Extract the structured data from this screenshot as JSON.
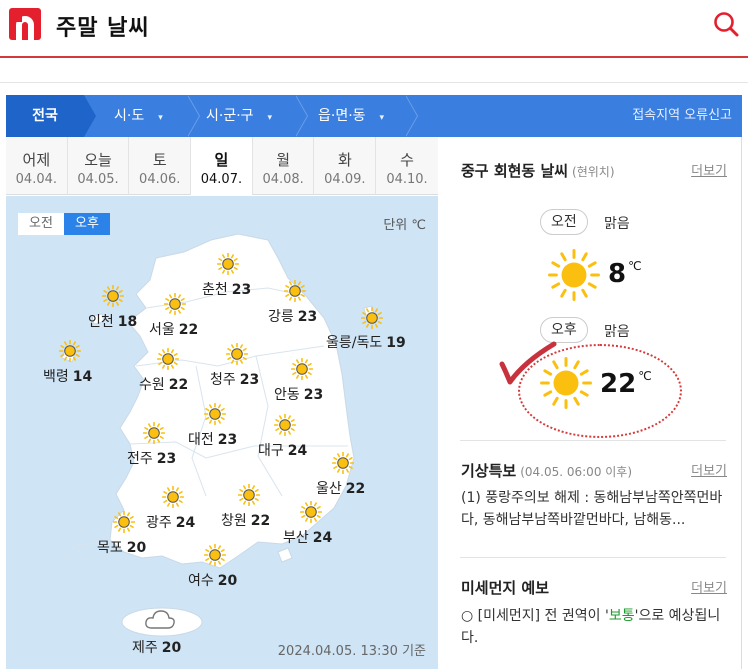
{
  "header": {
    "title": "주말 날씨"
  },
  "nav": {
    "first": "전국",
    "items": [
      {
        "label": "시·도",
        "caret": "▾"
      },
      {
        "label": "시·군·구",
        "caret": "▾"
      },
      {
        "label": "읍·면·동",
        "caret": "▾"
      }
    ],
    "report": "접속지역 오류신고"
  },
  "days": [
    {
      "name": "어제",
      "date": "04.04."
    },
    {
      "name": "오늘",
      "date": "04.05."
    },
    {
      "name": "토",
      "date": "04.06."
    },
    {
      "name": "일",
      "date": "04.07.",
      "active": true
    },
    {
      "name": "월",
      "date": "04.08."
    },
    {
      "name": "화",
      "date": "04.09."
    },
    {
      "name": "수",
      "date": "04.10."
    }
  ],
  "map": {
    "am_label": "오전",
    "pm_label": "오후",
    "unit": "단위 ℃",
    "timestamp": "2024.04.05. 13:30 기준",
    "cities": [
      {
        "name": "춘천",
        "temp": "23",
        "icon": "sun-icon"
      },
      {
        "name": "인천",
        "temp": "18",
        "icon": "sun-icon"
      },
      {
        "name": "서울",
        "temp": "22",
        "icon": "sun-icon"
      },
      {
        "name": "강릉",
        "temp": "23",
        "icon": "sun-icon"
      },
      {
        "name": "울릉/독도",
        "temp": "19",
        "icon": "sun-icon"
      },
      {
        "name": "백령",
        "temp": "14",
        "icon": "sun-icon"
      },
      {
        "name": "수원",
        "temp": "22",
        "icon": "sun-icon"
      },
      {
        "name": "청주",
        "temp": "23",
        "icon": "sun-icon"
      },
      {
        "name": "안동",
        "temp": "23",
        "icon": "sun-icon"
      },
      {
        "name": "대전",
        "temp": "23",
        "icon": "sun-icon"
      },
      {
        "name": "대구",
        "temp": "24",
        "icon": "sun-icon"
      },
      {
        "name": "전주",
        "temp": "23",
        "icon": "sun-icon"
      },
      {
        "name": "울산",
        "temp": "22",
        "icon": "sun-icon"
      },
      {
        "name": "광주",
        "temp": "24",
        "icon": "sun-icon"
      },
      {
        "name": "창원",
        "temp": "22",
        "icon": "sun-icon"
      },
      {
        "name": "부산",
        "temp": "24",
        "icon": "sun-icon"
      },
      {
        "name": "목포",
        "temp": "20",
        "icon": "sun-icon"
      },
      {
        "name": "여수",
        "temp": "20",
        "icon": "sun-icon"
      },
      {
        "name": "제주",
        "temp": "20",
        "icon": "cloud-icon"
      }
    ]
  },
  "local": {
    "title": "중구 회현동 날씨",
    "sub": "(현위치)",
    "more": "더보기",
    "am": {
      "label": "오전",
      "condition": "맑음",
      "temp": "8",
      "unit": "℃"
    },
    "pm": {
      "label": "오후",
      "condition": "맑음",
      "temp": "22",
      "unit": "℃"
    }
  },
  "special": {
    "title": "기상특보",
    "sub": "(04.05. 06:00 이후)",
    "more": "더보기",
    "text": "(1) 풍랑주의보 해제 : 동해남부남쪽안쪽먼바다, 동해남부남쪽바깥먼바다, 남해동..."
  },
  "dust": {
    "title": "미세먼지 예보",
    "more": "더보기",
    "prefix": "○ [미세먼지] 전 권역이 ",
    "quote_open": "'",
    "level": "보통",
    "quote_close": "'",
    "suffix": "으로 예상됩니다."
  },
  "colors": {
    "brand": "#e4202e",
    "nav": "#3a7fe0",
    "nav_active": "#1f64c8",
    "sea": "#cfe4f5",
    "land": "#ffffff",
    "sun": "#fbbf0f",
    "highlight": "#d63a3a"
  }
}
